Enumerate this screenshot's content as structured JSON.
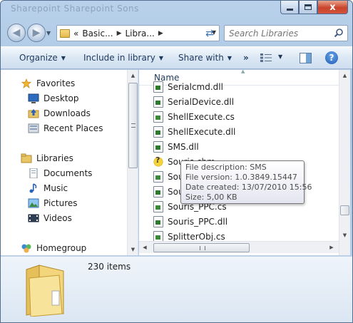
{
  "window": {
    "title": "Sharepoint   Sharepoint   Sons"
  },
  "caption": {
    "close_label": "x"
  },
  "nav": {
    "breadcrumb": [
      "«",
      "Basic...",
      "Libra..."
    ],
    "search_placeholder": "Search Libraries"
  },
  "toolbar": {
    "organize": "Organize",
    "include": "Include in library",
    "share": "Share with",
    "more": "»",
    "help": "?"
  },
  "navpane": {
    "favorites": "Favorites",
    "desktop": "Desktop",
    "downloads": "Downloads",
    "recent": "Recent Places",
    "libraries": "Libraries",
    "documents": "Documents",
    "music": "Music",
    "pictures": "Pictures",
    "videos": "Videos",
    "homegroup": "Homegroup"
  },
  "filelist": {
    "column_name": "Name",
    "files": [
      {
        "name": "Serialcmd.dll",
        "type": "dll"
      },
      {
        "name": "SerialDevice.dll",
        "type": "dll"
      },
      {
        "name": "ShellExecute.cs",
        "type": "cs"
      },
      {
        "name": "ShellExecute.dll",
        "type": "dll"
      },
      {
        "name": "SMS.dll",
        "type": "dll"
      },
      {
        "name": "Souris.chm",
        "type": "chm"
      },
      {
        "name": "Souris.cs",
        "type": "cs"
      },
      {
        "name": "Souris.dll",
        "type": "dll"
      },
      {
        "name": "Souris_PPC.cs",
        "type": "cs"
      },
      {
        "name": "Souris_PPC.dll",
        "type": "dll"
      },
      {
        "name": "SplitterObj.cs",
        "type": "cs"
      }
    ]
  },
  "tooltip": {
    "line1": "File description: SMS",
    "line2": "File version: 1.0.3849.15447",
    "line3": "Date created: 13/07/2010 15:56",
    "line4": "Size: 5,00 KB"
  },
  "details": {
    "count": "230 items"
  },
  "colors": {
    "frame": "#b9d1ea",
    "toolbar_text": "#1e395b",
    "close_button": "#c9432b",
    "help_button": "#1d5cb5"
  },
  "icons": [
    "back-icon",
    "forward-icon",
    "refresh-icon",
    "search-icon",
    "views-icon",
    "preview-pane-icon",
    "help-icon",
    "star-icon",
    "desktop-icon",
    "downloads-icon",
    "recent-places-icon",
    "libraries-icon",
    "documents-icon",
    "music-icon",
    "pictures-icon",
    "videos-icon",
    "homegroup-icon",
    "folder-icon"
  ]
}
